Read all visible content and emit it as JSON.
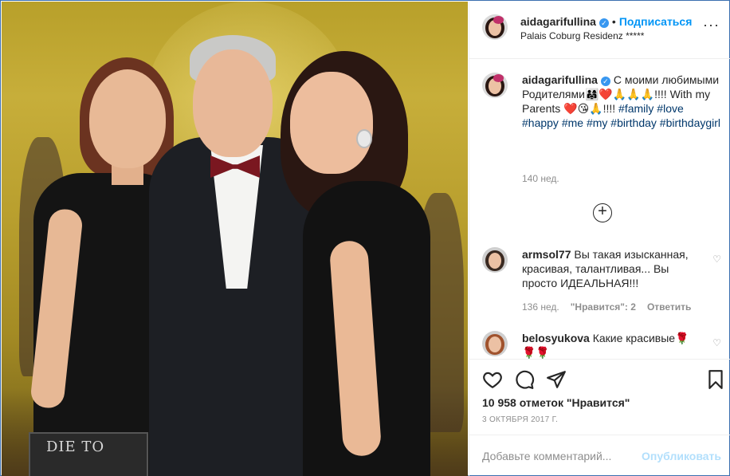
{
  "post": {
    "username": "aidagarifullina",
    "follow_label": "Подписаться",
    "location": "Palais Coburg Residenz *****",
    "more_icon": "more-options-icon"
  },
  "caption": {
    "username": "aidagarifullina",
    "text_before": "С моими любимыми Родителями👨‍👩‍👧❤️🙏🙏🙏!!!! With my Parents ❤️😘🙏!!!! ",
    "hashtags": [
      "#family",
      "#love",
      "#happy",
      "#me",
      "#my",
      "#birthday",
      "#birthdaygirl"
    ],
    "time": "140 нед."
  },
  "load_more_icon": "plus-circle-icon",
  "comments": [
    {
      "username": "armsol77",
      "text": "Вы такая изысканная, красивая, талантливая... Вы просто ИДЕАЛЬНАЯ!!!",
      "time": "136 нед.",
      "likes": "\"Нравится\": 2",
      "reply": "Ответить"
    },
    {
      "username": "belosyukova",
      "text": "Какие красивые🌹🌹🌹"
    }
  ],
  "actions": {
    "likes_text": "10 958 отметок \"Нравится\"",
    "date": "3 ОКТЯБРЯ 2017 Г."
  },
  "add_comment": {
    "placeholder": "Добавьте комментарий...",
    "post_label": "Опубликовать"
  },
  "photo": {
    "clutch_text": "DIE TO"
  },
  "colors": {
    "link_blue": "#0095f6",
    "hashtag": "#00376b",
    "muted": "#8e8e8e",
    "verified": "#3897f0"
  }
}
